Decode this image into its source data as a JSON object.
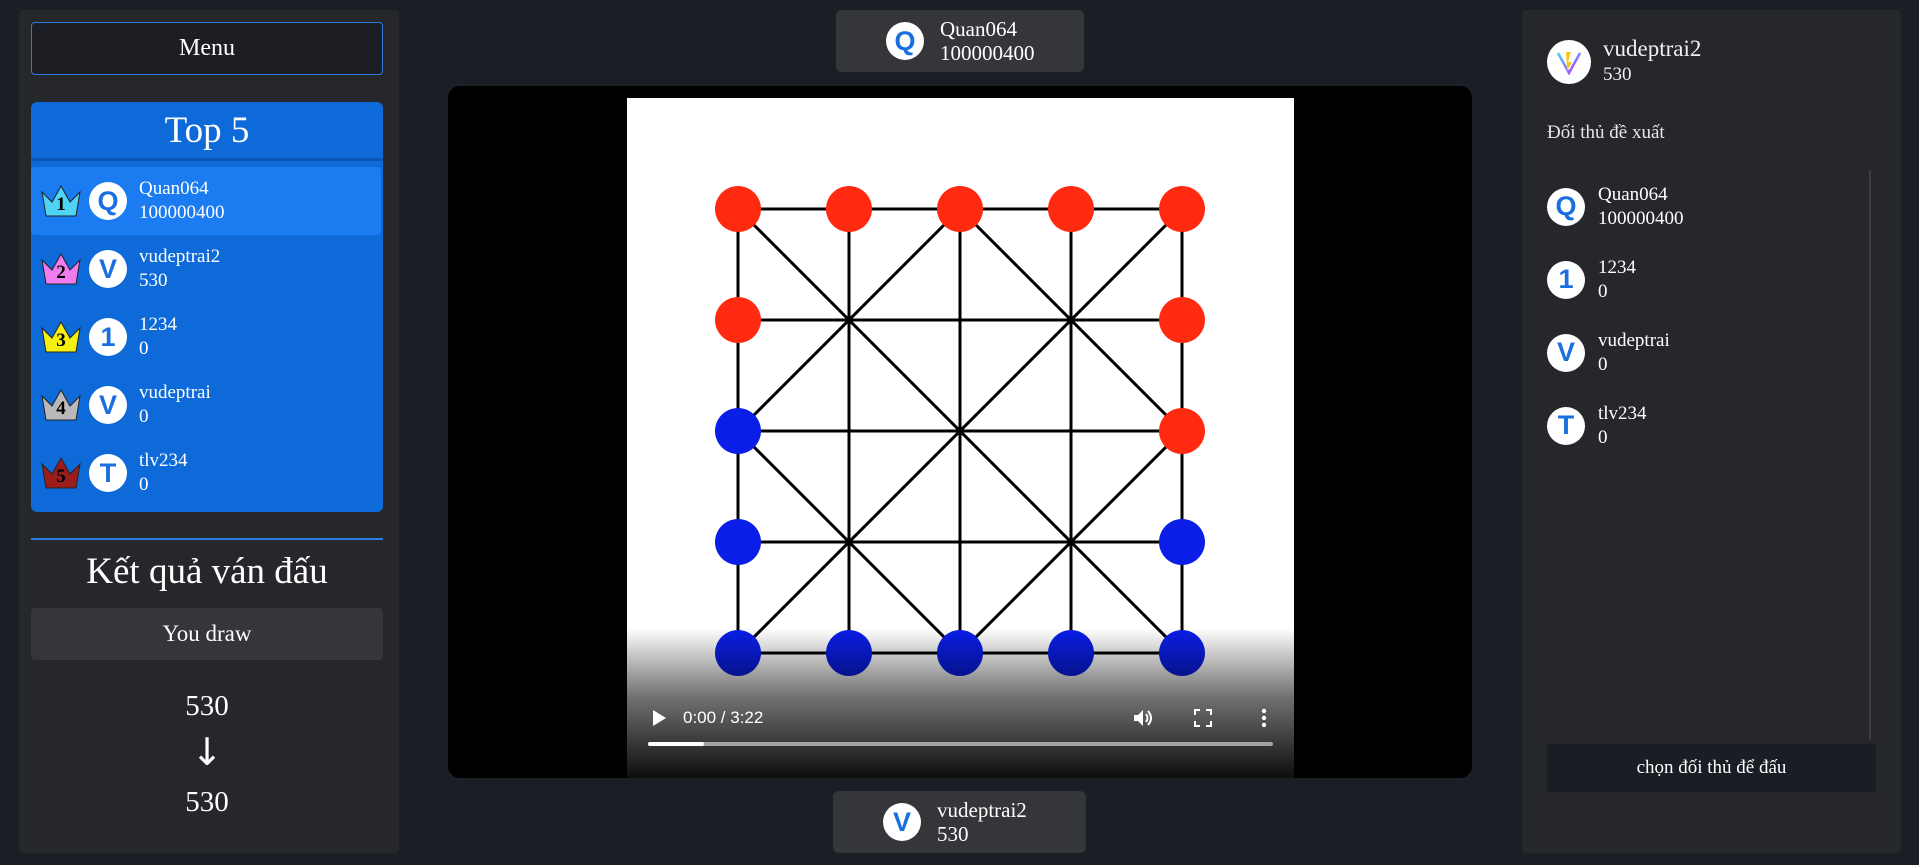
{
  "left": {
    "menu_label": "Menu",
    "top5_title": "Top 5",
    "ranking": [
      {
        "rank": "1",
        "initial": "Q",
        "name": "Quan064",
        "score": "100000400",
        "crown_color": "#4fd3f7"
      },
      {
        "rank": "2",
        "initial": "V",
        "name": "vudeptrai2",
        "score": "530",
        "crown_color": "#f07cf0"
      },
      {
        "rank": "3",
        "initial": "1",
        "name": "1234",
        "score": "0",
        "crown_color": "#f5ef10"
      },
      {
        "rank": "4",
        "initial": "V",
        "name": "vudeptrai",
        "score": "0",
        "crown_color": "#b9b9b9"
      },
      {
        "rank": "5",
        "initial": "T",
        "name": "tlv234",
        "score": "0",
        "crown_color": "#9c1c1c"
      }
    ],
    "result_title": "Kết quả ván đấu",
    "result_text": "You draw",
    "score_before": "530",
    "score_arrow": "↓",
    "score_after": "530"
  },
  "center": {
    "top_player": {
      "initial": "Q",
      "name": "Quan064",
      "score": "100000400"
    },
    "bottom_player": {
      "initial": "V",
      "name": "vudeptrai2",
      "score": "530"
    },
    "video": {
      "time": "0:00 / 3:22",
      "progress_fraction": 0.09
    },
    "board": {
      "red_color": "#ff2a10",
      "blue_color": "#0a1ee8",
      "red_points": [
        [
          0,
          0
        ],
        [
          1,
          0
        ],
        [
          2,
          0
        ],
        [
          3,
          0
        ],
        [
          4,
          0
        ],
        [
          0,
          1
        ],
        [
          4,
          1
        ],
        [
          4,
          2
        ]
      ],
      "blue_points": [
        [
          0,
          2
        ],
        [
          0,
          3
        ],
        [
          4,
          3
        ],
        [
          0,
          4
        ],
        [
          1,
          4
        ],
        [
          2,
          4
        ],
        [
          3,
          4
        ],
        [
          4,
          4
        ]
      ]
    }
  },
  "right": {
    "me": {
      "name": "vudeptrai2",
      "score": "530"
    },
    "suggest_title": "Đối thủ đề xuất",
    "opponents": [
      {
        "initial": "Q",
        "name": "Quan064",
        "score": "100000400"
      },
      {
        "initial": "1",
        "name": "1234",
        "score": "0"
      },
      {
        "initial": "V",
        "name": "vudeptrai",
        "score": "0"
      },
      {
        "initial": "T",
        "name": "tlv234",
        "score": "0"
      }
    ],
    "choose_label": "chọn đối thủ để đấu"
  }
}
